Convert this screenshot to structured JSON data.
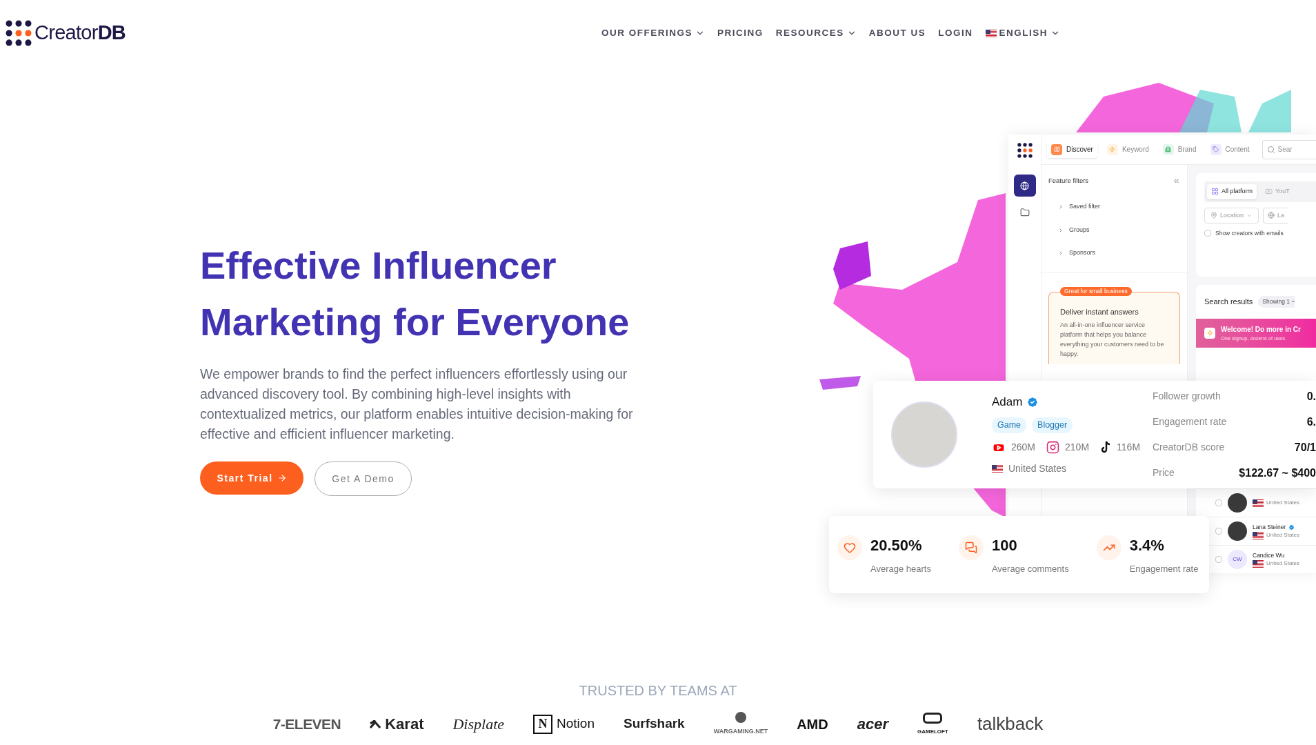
{
  "header": {
    "logo": {
      "light": "Creator",
      "bold": "DB"
    },
    "nav": [
      {
        "label": "OUR OFFERINGS",
        "kind": "menu"
      },
      {
        "label": "PRICING",
        "kind": "link"
      },
      {
        "label": "RESOURCES",
        "kind": "menu"
      },
      {
        "label": "ABOUT US",
        "kind": "link"
      },
      {
        "label": "LOGIN",
        "kind": "link"
      },
      {
        "label": "ENGLISH",
        "kind": "language"
      }
    ]
  },
  "hero": {
    "title_lines": [
      "Effective Influencer",
      "Marketing for Everyone"
    ],
    "body": "We empower brands to find the perfect influencers effortlessly using our advanced discovery tool. By combining high-level insights with contextualized metrics, our platform enables intuitive decision-making for effective and efficient influencer marketing.",
    "buttons": [
      {
        "label": "Start Trial",
        "kind": "primary"
      },
      {
        "label": "Get A Demo",
        "kind": "secondary"
      }
    ]
  },
  "app": {
    "tabs": [
      {
        "label": "Discover",
        "kind": "discover",
        "selected": true
      },
      {
        "label": "Keyword",
        "kind": "keyword",
        "selected": false
      },
      {
        "label": "Brand",
        "kind": "brand",
        "selected": false
      },
      {
        "label": "Content",
        "kind": "content",
        "selected": false
      }
    ],
    "search": {
      "placeholder": "Sear"
    },
    "filters_title": "Feature filters",
    "filters": [
      "Saved filter",
      "Groups",
      "Sponsors"
    ],
    "promo": {
      "badge": "Great for small business",
      "title": "Deliver instant answers",
      "body": "An all-in-one influencer service platform that helps you balance everything your customers need to be happy."
    },
    "platforms": [
      {
        "label": "All platform",
        "selected": true
      },
      {
        "label": "YouT",
        "selected": false
      }
    ],
    "location": {
      "placeholder": "Location"
    },
    "language": {
      "placeholder": "La"
    },
    "email_filter": {
      "label": "Show creators with emails",
      "checked": false
    },
    "results_title": "Search results",
    "results_count": "Showing 1 ~",
    "welcome": {
      "title": "Welcome! Do more in Cr",
      "subtitle": "One signup, dozens of uses."
    },
    "creators": [
      {
        "country": "United States",
        "checked": false,
        "kind": "photo"
      },
      {
        "name": "Lana Steiner",
        "country": "United States",
        "verified": true,
        "checked": false,
        "kind": "photo"
      },
      {
        "name": "Candice Wu",
        "country": "United States",
        "checked": false,
        "kind": "initials",
        "initials": "CW"
      }
    ]
  },
  "profile": {
    "name": "Adam",
    "verified": true,
    "tags": [
      "Game",
      "Blogger"
    ],
    "socials": [
      {
        "kind": "youtube",
        "count": "260M"
      },
      {
        "kind": "instagram",
        "count": "210M"
      },
      {
        "kind": "tiktok",
        "count": "116M"
      }
    ],
    "country": "United States",
    "metrics": [
      {
        "label": "Follower growth",
        "value": "0."
      },
      {
        "label": "Engagement rate",
        "value": "6."
      },
      {
        "label": "CreatorDB score",
        "value": "70/1"
      },
      {
        "label": "Price",
        "value": "$122.67 ~ $400"
      }
    ]
  },
  "stats": [
    {
      "kind": "hearts",
      "value": "20.50%",
      "label": "Average hearts"
    },
    {
      "kind": "comments",
      "value": "100",
      "label": "Average comments"
    },
    {
      "kind": "trend",
      "value": "3.4%",
      "label": "Engagement rate"
    }
  ],
  "trusted": {
    "title": "TRUSTED BY TEAMS AT",
    "logos": [
      {
        "kind": "plain",
        "text": "7-ELEVEN"
      },
      {
        "kind": "karat",
        "text": "Karat"
      },
      {
        "kind": "script",
        "text": "Displate"
      },
      {
        "kind": "notion",
        "mark": "N",
        "text": "Notion"
      },
      {
        "kind": "surfshark",
        "text": "Surfshark"
      },
      {
        "kind": "wargaming",
        "text": "WARGAMING.NET"
      },
      {
        "kind": "amd",
        "text": "AMD"
      },
      {
        "kind": "acer",
        "text": "acer"
      },
      {
        "kind": "gameloft",
        "text": "GAMELOFT"
      },
      {
        "kind": "talkback",
        "text": "talkback"
      }
    ]
  }
}
